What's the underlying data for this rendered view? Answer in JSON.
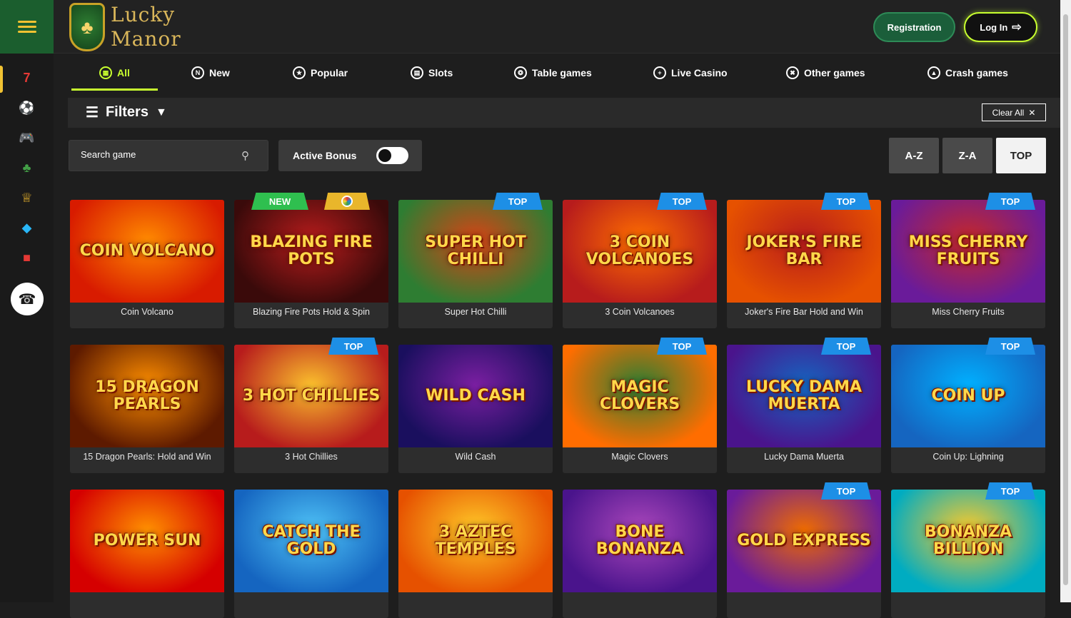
{
  "brand": {
    "name_line1": "Lucky",
    "name_line2": "Manor",
    "accent": "#c8ff2f",
    "gold": "#d9b65a",
    "green": "#1b5e2e"
  },
  "header": {
    "register_label": "Registration",
    "login_label": "Log In"
  },
  "sidebar": {
    "items": [
      "seven-icon",
      "ball-icon",
      "gamepad-icon",
      "clover-icon",
      "crown-icon",
      "fish-icon",
      "chest-icon"
    ],
    "support": "headset-icon"
  },
  "tabs": [
    {
      "label": "All",
      "icon": "grid-icon",
      "active": true
    },
    {
      "label": "New",
      "icon": "n-icon"
    },
    {
      "label": "Popular",
      "icon": "popular-icon"
    },
    {
      "label": "Slots",
      "icon": "slots-icon"
    },
    {
      "label": "Table games",
      "icon": "roulette-icon"
    },
    {
      "label": "Live Casino",
      "icon": "live-icon"
    },
    {
      "label": "Other games",
      "icon": "other-icon"
    },
    {
      "label": "Crash games",
      "icon": "crash-icon"
    }
  ],
  "filters": {
    "label": "Filters",
    "clear_label": "Clear All"
  },
  "search": {
    "placeholder": "Search game"
  },
  "active_bonus": {
    "label": "Active Bonus",
    "enabled": false
  },
  "sort": {
    "az": "A-Z",
    "za": "Z-A",
    "top": "TOP",
    "selected": "TOP"
  },
  "badges": {
    "top": "TOP",
    "new": "NEW"
  },
  "games": [
    {
      "name": "Coin Volcano",
      "art": "COIN VOLCANO",
      "badge": ""
    },
    {
      "name": "Blazing Fire Pots Hold & Spin",
      "art": "BLAZING FIRE POTS",
      "badge": "new"
    },
    {
      "name": "Super Hot Chilli",
      "art": "SUPER HOT CHILLI",
      "badge": "top"
    },
    {
      "name": "3 Coin Volcanoes",
      "art": "3 COIN VOLCANOES",
      "badge": "top"
    },
    {
      "name": "Joker's Fire Bar Hold and Win",
      "art": "JOKER'S FIRE BAR",
      "badge": "top"
    },
    {
      "name": "Miss Cherry Fruits",
      "art": "MISS CHERRY FRUITS",
      "badge": "top"
    },
    {
      "name": "15 Dragon Pearls: Hold and Win",
      "art": "15 DRAGON PEARLS",
      "badge": ""
    },
    {
      "name": "3 Hot Chillies",
      "art": "3 HOT CHILLIES",
      "badge": "top"
    },
    {
      "name": "Wild Cash",
      "art": "WILD CASH",
      "badge": ""
    },
    {
      "name": "Magic Clovers",
      "art": "MAGIC CLOVERS",
      "badge": "top"
    },
    {
      "name": "Lucky Dama Muerta",
      "art": "LUCKY DAMA MUERTA",
      "badge": "top"
    },
    {
      "name": "Coin Up: Lighning",
      "art": "COIN UP",
      "badge": "top"
    },
    {
      "name": "",
      "art": "POWER SUN",
      "badge": ""
    },
    {
      "name": "",
      "art": "CATCH THE GOLD",
      "badge": ""
    },
    {
      "name": "",
      "art": "3 AZTEC TEMPLES",
      "badge": ""
    },
    {
      "name": "",
      "art": "BONE BONANZA",
      "badge": ""
    },
    {
      "name": "",
      "art": "GOLD EXPRESS",
      "badge": "top"
    },
    {
      "name": "",
      "art": "BONANZA BILLION",
      "badge": "top"
    }
  ],
  "thumb_colors": [
    [
      "#d81b00",
      "#ff8a00"
    ],
    [
      "#3a0a0a",
      "#b71c1c"
    ],
    [
      "#2e7d32",
      "#d84315"
    ],
    [
      "#b71c1c",
      "#ff6f00"
    ],
    [
      "#e65100",
      "#b71c1c"
    ],
    [
      "#6a1b9a",
      "#c62828"
    ],
    [
      "#5d1a00",
      "#ff8f00"
    ],
    [
      "#b71c1c",
      "#fbc02d"
    ],
    [
      "#1a0f5e",
      "#7b1fa2"
    ],
    [
      "#ff6d00",
      "#2e7d32"
    ],
    [
      "#4a148c",
      "#1565c0"
    ],
    [
      "#1565c0",
      "#00b0ff"
    ],
    [
      "#d50000",
      "#ff9100"
    ],
    [
      "#1565c0",
      "#4fc3f7"
    ],
    [
      "#e65100",
      "#ffca28"
    ],
    [
      "#4a148c",
      "#ab47bc"
    ],
    [
      "#6a1b9a",
      "#ef6c00"
    ],
    [
      "#00acc1",
      "#ffca28"
    ]
  ]
}
